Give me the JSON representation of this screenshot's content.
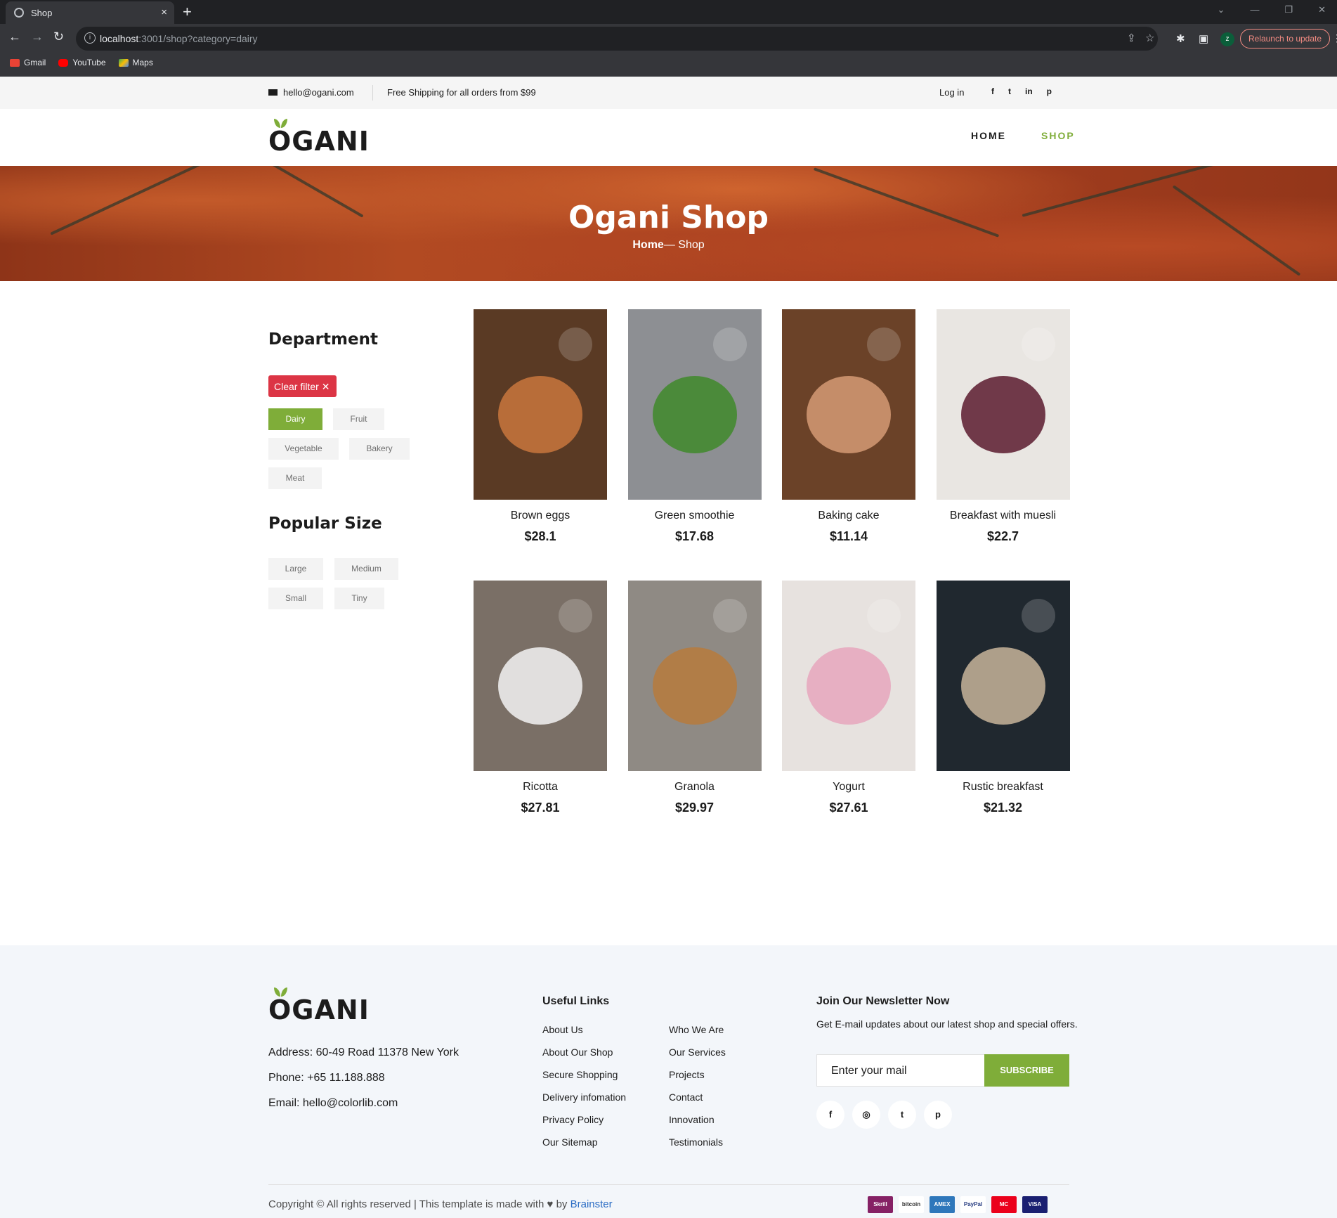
{
  "browser": {
    "tab_title": "Shop",
    "url_host": "localhost",
    "url_rest": ":3001/shop?category=dairy",
    "relaunch_label": "Relaunch to update",
    "avatar_letter": "z",
    "bookmarks": [
      "Gmail",
      "YouTube",
      "Maps"
    ]
  },
  "topbar": {
    "email": "hello@ogani.com",
    "shipping": "Free Shipping for all orders from $99",
    "login": "Log in",
    "social": [
      "f",
      "t",
      "in",
      "p"
    ]
  },
  "header": {
    "logo": "OGANI",
    "nav": [
      "HOME",
      "SHOP"
    ],
    "active_nav": "SHOP"
  },
  "hero": {
    "title": "Ogani Shop",
    "crumb_home": "Home",
    "crumb_sep": "—",
    "crumb_current": "Shop"
  },
  "sidebar": {
    "department_title": "Department",
    "clear_filter": "Clear filter",
    "categories": [
      "Dairy",
      "Fruit",
      "Vegetable",
      "Bakery",
      "Meat"
    ],
    "active_category": "Dairy",
    "size_title": "Popular Size",
    "sizes": [
      "Large",
      "Medium",
      "Small",
      "Tiny"
    ]
  },
  "products": [
    {
      "name": "Brown eggs",
      "price": "$28.1",
      "bg": "#5a3a24",
      "accent": "#c9773d"
    },
    {
      "name": "Green smoothie",
      "price": "$17.68",
      "bg": "#8d8f93",
      "accent": "#3f8a2a"
    },
    {
      "name": "Baking cake",
      "price": "$11.14",
      "bg": "#6b4228",
      "accent": "#d59a74"
    },
    {
      "name": "Breakfast with muesli",
      "price": "$22.7",
      "bg": "#e9e6e2",
      "accent": "#5a1a2e"
    },
    {
      "name": "Ricotta",
      "price": "$27.81",
      "bg": "#7a6f66",
      "accent": "#f3f3f3"
    },
    {
      "name": "Granola",
      "price": "$29.97",
      "bg": "#8f8a84",
      "accent": "#b77a3c"
    },
    {
      "name": "Yogurt",
      "price": "$27.61",
      "bg": "#e7e2df",
      "accent": "#e6a6bd"
    },
    {
      "name": "Rustic breakfast",
      "price": "$21.32",
      "bg": "#20282f",
      "accent": "#c8b49a"
    }
  ],
  "footer": {
    "logo": "OGANI",
    "address": "Address: 60-49 Road 11378 New York",
    "phone": "Phone: +65 11.188.888",
    "email": "Email: hello@colorlib.com",
    "useful_title": "Useful Links",
    "links_col1": [
      "About Us",
      "About Our Shop",
      "Secure Shopping",
      "Delivery infomation",
      "Privacy Policy",
      "Our Sitemap"
    ],
    "links_col2": [
      "Who We Are",
      "Our Services",
      "Projects",
      "Contact",
      "Innovation",
      "Testimonials"
    ],
    "newsletter_title": "Join Our Newsletter Now",
    "newsletter_note": "Get E-mail updates about our latest shop and special offers.",
    "input_placeholder": "Enter your mail",
    "subscribe": "SUBSCRIBE",
    "social": [
      "f",
      "◎",
      "t",
      "p"
    ],
    "copyright": "Copyright © All rights reserved | This template is made with",
    "by": "by",
    "brand": "Brainster",
    "payments": [
      "Skrill",
      "bitcoin",
      "AMEX",
      "PayPal",
      "MC",
      "VISA"
    ]
  }
}
